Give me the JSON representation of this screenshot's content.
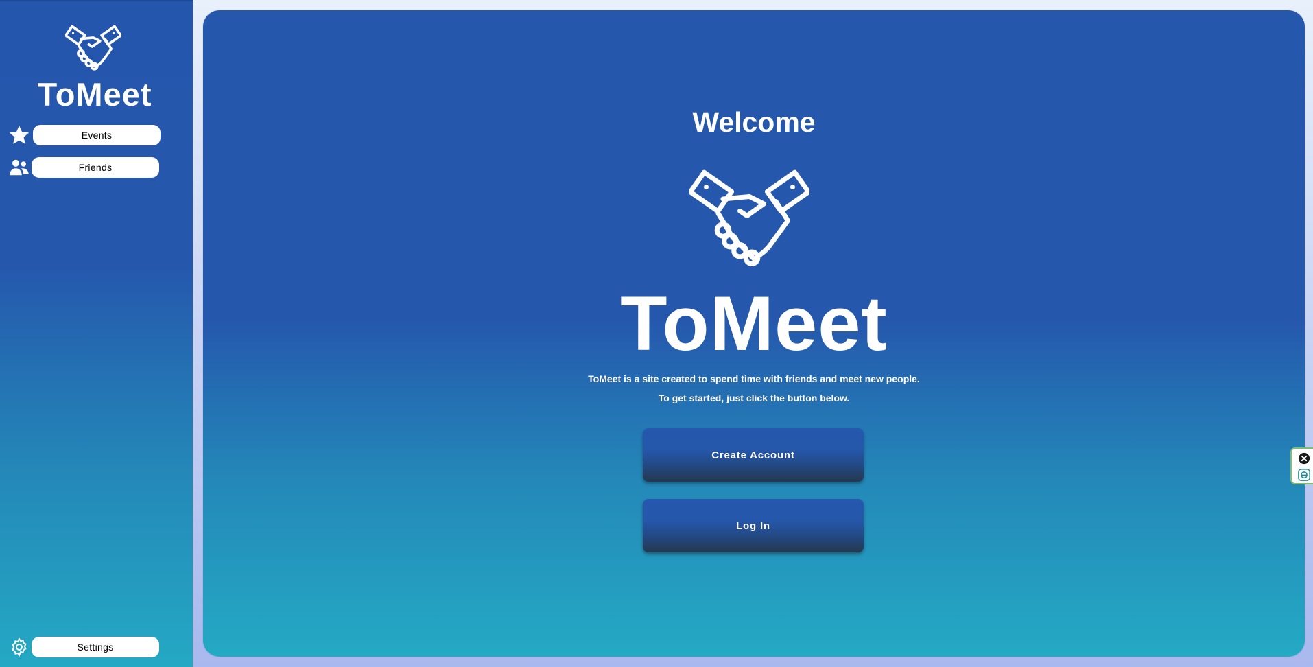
{
  "sidebar": {
    "logo_icon": "handshake-icon",
    "title": "ToMeet",
    "nav": [
      {
        "icon": "star-icon",
        "label": "Events"
      },
      {
        "icon": "users-icon",
        "label": "Friends"
      }
    ],
    "settings": {
      "icon": "gear-icon",
      "label": "Settings"
    }
  },
  "main": {
    "welcome": "Welcome",
    "logo_icon": "handshake-icon",
    "title": "ToMeet",
    "description_line1": "ToMeet is a site created to spend time with friends and meet new people.",
    "description_line2": "To get started, just click the button below.",
    "buttons": {
      "create_account": "Create Account",
      "log_in": "Log In"
    }
  },
  "extension": {
    "close_icon": "close-circle-icon",
    "extension_icon": "e-icon"
  },
  "colors": {
    "primary_blue": "#2558ad",
    "teal": "#24aac4",
    "text": "#ffffff"
  }
}
